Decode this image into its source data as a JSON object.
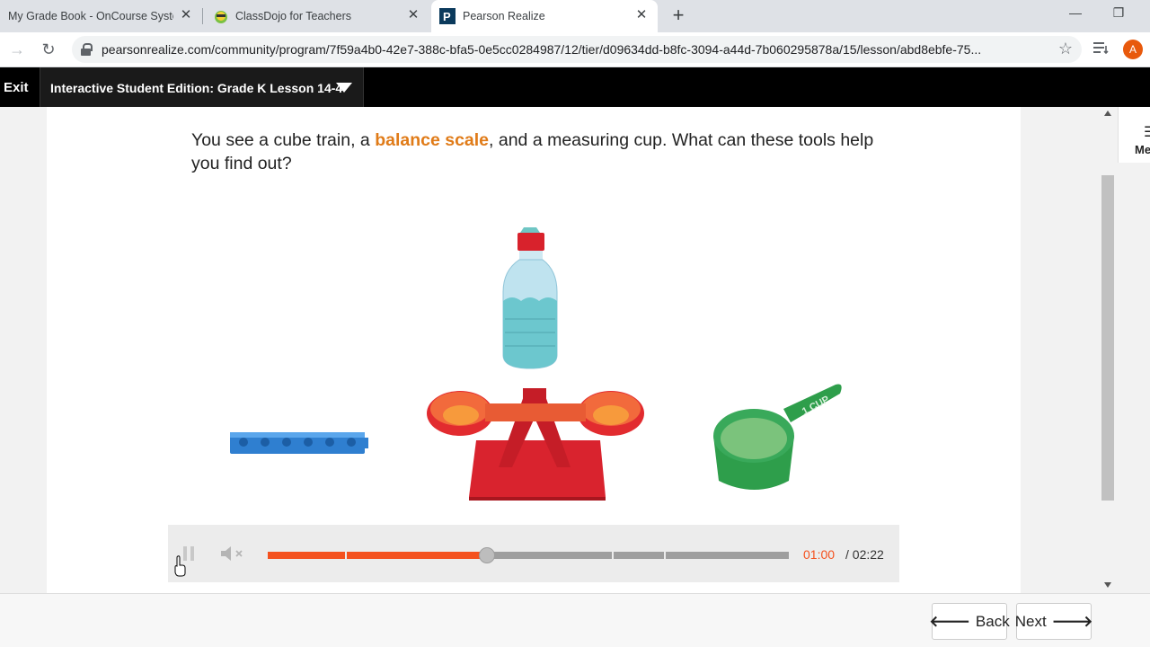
{
  "browser": {
    "tabs": [
      {
        "title": "My Grade Book - OnCourse Syste",
        "favicon": "grade-book-favicon"
      },
      {
        "title": "ClassDojo for Teachers",
        "favicon": "classdojo-favicon"
      },
      {
        "title": "Pearson Realize",
        "favicon": "pearson-favicon",
        "active": true
      }
    ],
    "url": "pearsonrealize.com/community/program/7f59a4b0-42e7-388c-bfa5-0e5cc0284987/12/tier/d09634dd-b8fc-3094-a44d-7b060295878a/15/lesson/abd8ebfe-75...",
    "profile_initial": "A"
  },
  "app": {
    "exit_label": "Exit",
    "lesson_title": "Interactive Student Edition: Grade K Lesson 14-4",
    "menu_label": "Me"
  },
  "content": {
    "question_prefix": "You see a cube train, a ",
    "question_highlight": "balance scale",
    "question_suffix": ", and a measuring cup. What can these tools help you find out?",
    "cup_label": "1 CUP"
  },
  "video": {
    "current_time": "01:00",
    "duration": "/ 02:22",
    "progress": 0.42
  },
  "nav": {
    "back_label": "Back",
    "next_label": "Next"
  },
  "colors": {
    "highlight": "#e07b18",
    "progress_fill": "#f4511e",
    "header_bg": "#000000"
  }
}
